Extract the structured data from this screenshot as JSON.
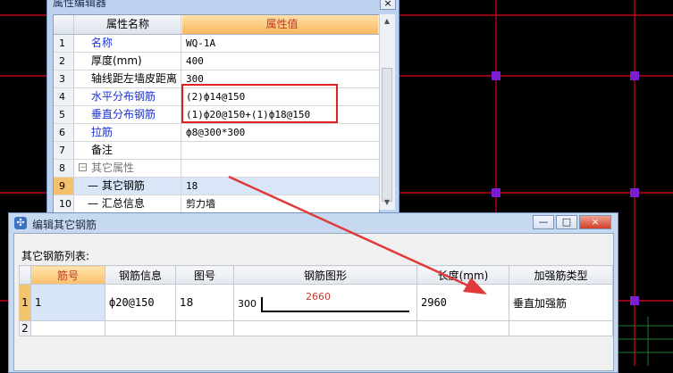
{
  "property_editor": {
    "title": "属性编辑器",
    "close": "×",
    "header": {
      "name": "属性名称",
      "value": "属性值"
    },
    "rows": [
      {
        "n": "1",
        "name": "名称",
        "value": "WQ-1A",
        "style": "blue"
      },
      {
        "n": "2",
        "name": "厚度(mm)",
        "value": "400",
        "style": ""
      },
      {
        "n": "3",
        "name": "轴线距左墙皮距离",
        "value": "300",
        "style": ""
      },
      {
        "n": "4",
        "name": "水平分布钢筋",
        "value": "(2)ф14@150",
        "style": "blue"
      },
      {
        "n": "5",
        "name": "垂直分布钢筋",
        "value": "(1)ф20@150+(1)ф18@150",
        "style": "blue"
      },
      {
        "n": "6",
        "name": "拉筋",
        "value": "ф8@300*300",
        "style": "blue"
      },
      {
        "n": "7",
        "name": "备注",
        "value": "",
        "style": ""
      },
      {
        "n": "8",
        "name": "其它属性",
        "value": "",
        "style": "grey"
      },
      {
        "n": "9",
        "name": "其它钢筋",
        "value": "18",
        "style": ""
      },
      {
        "n": "10",
        "name": "汇总信息",
        "value": "剪力墙",
        "style": ""
      }
    ]
  },
  "dialog": {
    "title": "编辑其它钢筋",
    "list_label": "其它钢筋列表:",
    "columns": [
      "筋号",
      "钢筋信息",
      "图号",
      "钢筋图形",
      "长度(mm)",
      "加强筋类型"
    ],
    "rows": [
      {
        "n": "1",
        "bar_no": "1",
        "info": "ф20@150",
        "fig": "18",
        "shape_left": "300",
        "shape_mid": "2660",
        "length": "2960",
        "type": "垂直加强筋"
      },
      {
        "n": "2",
        "bar_no": "",
        "info": "",
        "fig": "",
        "shape_left": "",
        "shape_mid": "",
        "length": "",
        "type": ""
      }
    ],
    "buttons": {
      "minimize": "—",
      "maximize": "□",
      "close": "×"
    }
  },
  "colors": {
    "highlight_box": "#e02020",
    "arrow": "#e03a3a",
    "cad_grid": "#c0001e",
    "cad_node": "#7a1fd0"
  }
}
